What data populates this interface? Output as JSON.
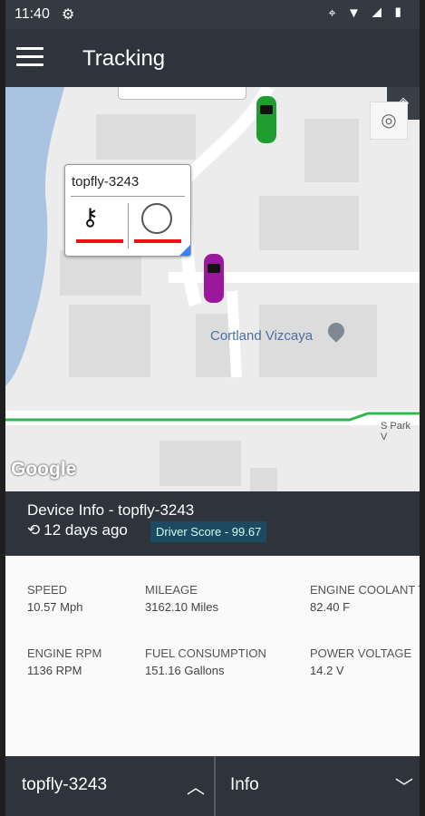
{
  "status_bar": {
    "time": "11:40",
    "icons": [
      "gear-icon",
      "location-icon",
      "wifi-icon",
      "signal-icon",
      "battery-icon"
    ]
  },
  "app_bar": {
    "title": "Tracking"
  },
  "map": {
    "popup_device": "topfly-3243",
    "place_label": "Cortland Vizcaya",
    "street_label": "S Park V",
    "attribution": "Google"
  },
  "device_info": {
    "title": "Device Info - topfly-3243",
    "last_seen": "12 days ago",
    "driver_score": "Driver Score - 99.67"
  },
  "stats": [
    {
      "label": "SPEED",
      "value": "10.57 Mph"
    },
    {
      "label": "MILEAGE",
      "value": "3162.10 Miles"
    },
    {
      "label": "ENGINE COOLANT T",
      "value": "82.40 F"
    },
    {
      "label": "ENGINE RPM",
      "value": "1136 RPM"
    },
    {
      "label": "FUEL CONSUMPTION",
      "value": "151.16 Gallons"
    },
    {
      "label": "POWER VOLTAGE",
      "value": "14.2 V"
    }
  ],
  "bottom_bar": {
    "device": "topfly-3243",
    "tab": "Info"
  }
}
